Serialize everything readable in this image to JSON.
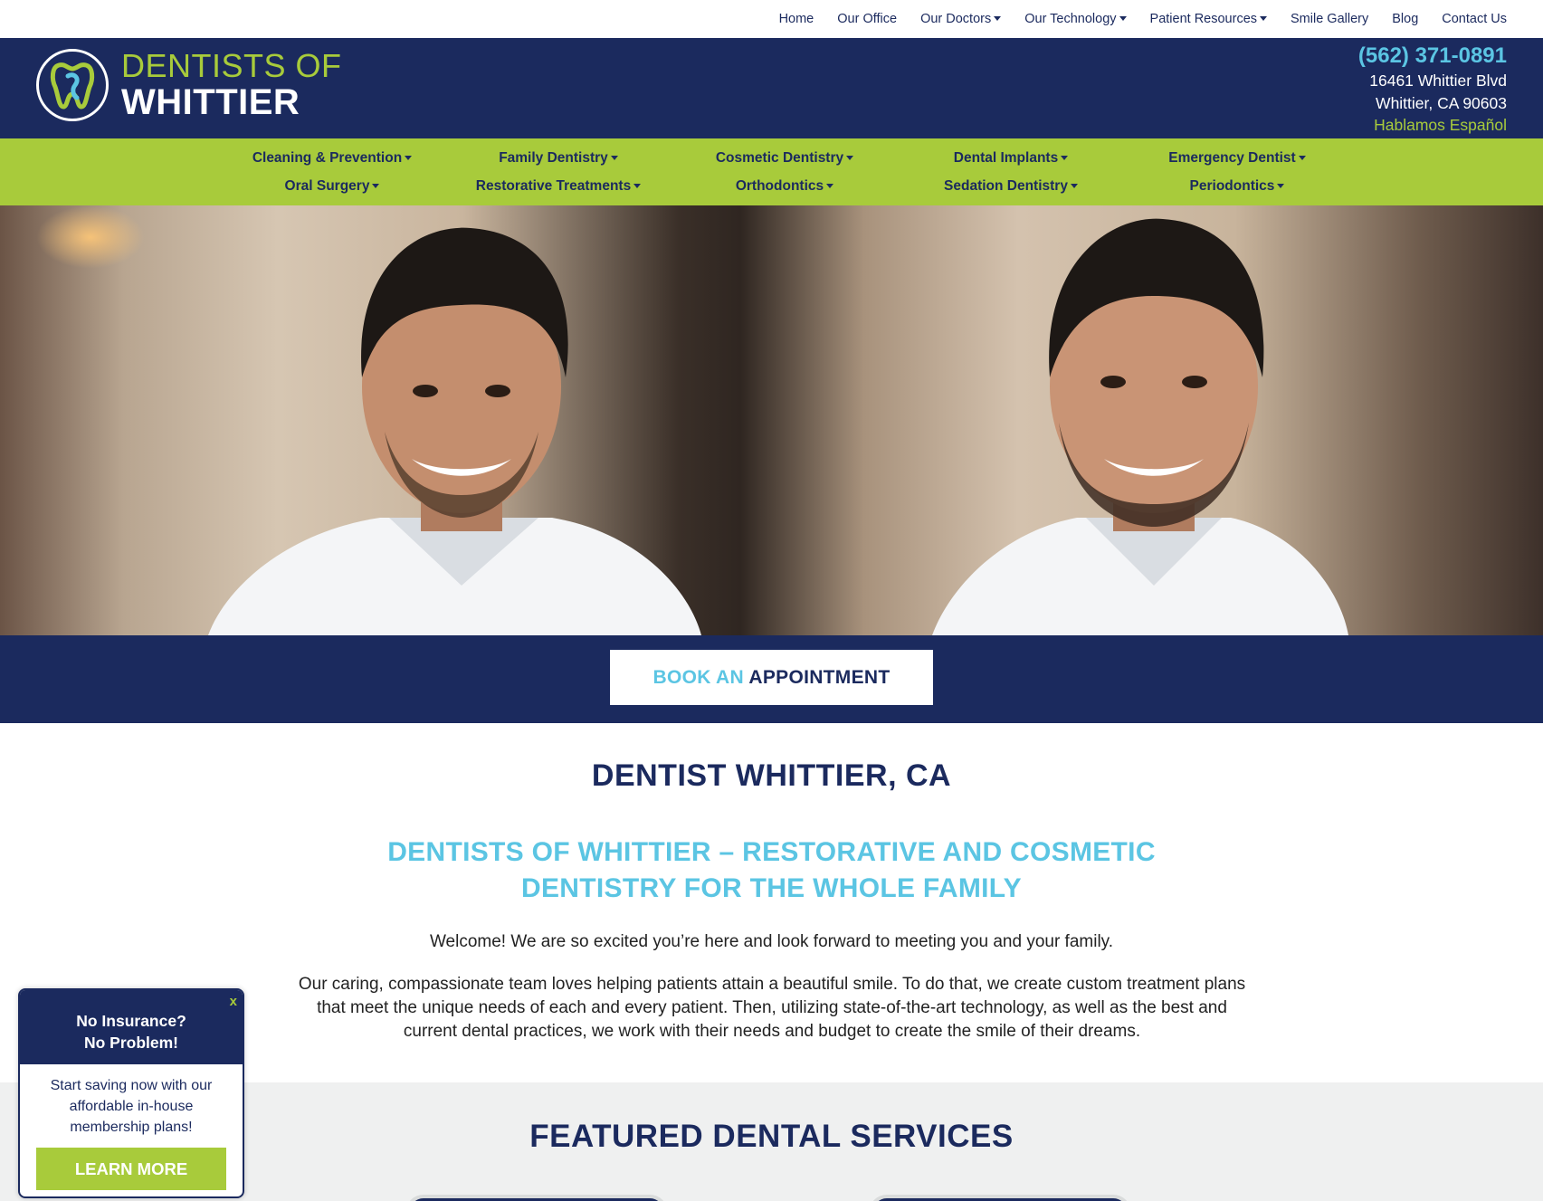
{
  "topnav": {
    "items": [
      {
        "label": "Home",
        "dropdown": false
      },
      {
        "label": "Our Office",
        "dropdown": false
      },
      {
        "label": "Our Doctors",
        "dropdown": true
      },
      {
        "label": "Our Technology",
        "dropdown": true
      },
      {
        "label": "Patient Resources",
        "dropdown": true
      },
      {
        "label": "Smile Gallery",
        "dropdown": false
      },
      {
        "label": "Blog",
        "dropdown": false
      },
      {
        "label": "Contact Us",
        "dropdown": false
      }
    ]
  },
  "header": {
    "logo_line1": "DENTISTS OF",
    "logo_line2": "WHITTIER",
    "phone": "(562) 371-0891",
    "address_line1": "16461 Whittier Blvd",
    "address_line2": "Whittier, CA 90603",
    "spanish": "Hablamos Español"
  },
  "services": [
    "Cleaning & Prevention",
    "Family Dentistry",
    "Cosmetic Dentistry",
    "Dental Implants",
    "Emergency Dentist",
    "Oral Surgery",
    "Restorative Treatments",
    "Orthodontics",
    "Sedation Dentistry",
    "Periodontics"
  ],
  "appointment": {
    "book_an": "BOOK AN",
    "appointment": "APPOINTMENT"
  },
  "content": {
    "h1": "DENTIST WHITTIER, CA",
    "h2": "DENTISTS OF WHITTIER – RESTORATIVE AND COSMETIC DENTISTRY FOR THE WHOLE FAMILY",
    "welcome": "Welcome! We are so excited you’re here and look forward to meeting you and your family.",
    "body": "Our caring, compassionate team loves helping patients attain a beautiful smile. To do that, we create custom treatment plans that meet the unique needs of each and every patient. Then, utilizing state-of-the-art technology, as well as the best and current dental practices, we work with their needs and budget to create the smile of their dreams."
  },
  "featured": {
    "title": "FEATURED DENTAL SERVICES"
  },
  "popup": {
    "close": "x",
    "title_line1": "No Insurance?",
    "title_line2": "No Problem!",
    "body": "Start saving now with our affordable in-house membership plans!",
    "button": "LEARN MORE"
  },
  "colors": {
    "navy": "#1b2a5e",
    "lime": "#a8cb3b",
    "sky": "#5bc5e3"
  }
}
